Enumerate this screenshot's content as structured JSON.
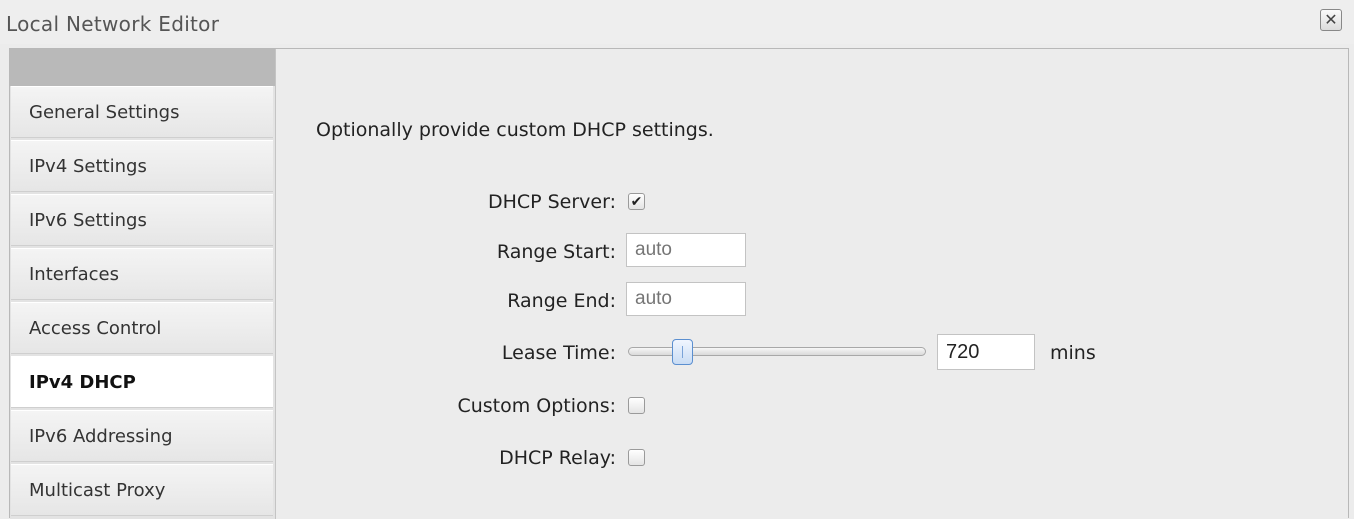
{
  "window": {
    "title": "Local Network Editor",
    "close_symbol": "✕"
  },
  "sidebar": {
    "items": [
      {
        "label": "General Settings",
        "active": false
      },
      {
        "label": "IPv4 Settings",
        "active": false
      },
      {
        "label": "IPv6 Settings",
        "active": false
      },
      {
        "label": "Interfaces",
        "active": false
      },
      {
        "label": "Access Control",
        "active": false
      },
      {
        "label": "IPv4 DHCP",
        "active": true
      },
      {
        "label": "IPv6 Addressing",
        "active": false
      },
      {
        "label": "Multicast Proxy",
        "active": false
      }
    ]
  },
  "form": {
    "description": "Optionally provide custom DHCP settings.",
    "dhcp_server": {
      "label": "DHCP Server:",
      "checked": true
    },
    "range_start": {
      "label": "Range Start:",
      "value": "",
      "placeholder": "auto"
    },
    "range_end": {
      "label": "Range End:",
      "value": "",
      "placeholder": "auto"
    },
    "lease_time": {
      "label": "Lease Time:",
      "value": "720",
      "unit": "mins",
      "slider_fraction": 0.16
    },
    "custom_options": {
      "label": "Custom Options:",
      "checked": false
    },
    "dhcp_relay": {
      "label": "DHCP Relay:",
      "checked": false
    }
  },
  "icons": {
    "close": "close-icon",
    "check": "checkmark-icon"
  },
  "colors": {
    "slider_accent": "#5b8fd0",
    "sidebar_header": "#b9b9b9"
  }
}
